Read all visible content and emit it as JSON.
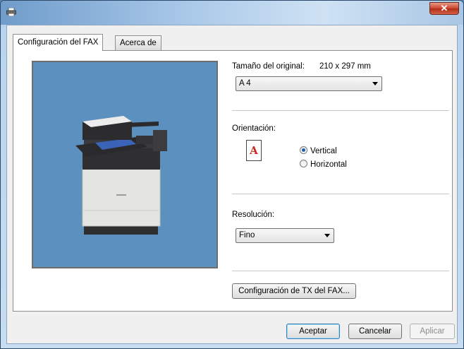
{
  "window": {
    "title": ""
  },
  "tabs": [
    {
      "label": "Configuración del FAX",
      "active": true
    },
    {
      "label": "Acerca de",
      "active": false
    }
  ],
  "original_size": {
    "label": "Tamaño del original:",
    "dimensions": "210 x 297 mm",
    "selected": "A 4"
  },
  "orientation": {
    "label": "Orientación:",
    "icon_letter": "A",
    "options": [
      {
        "label": "Vertical",
        "checked": true
      },
      {
        "label": "Horizontal",
        "checked": false
      }
    ]
  },
  "resolution": {
    "label": "Resolución:",
    "selected": "Fino"
  },
  "tx_settings_button": "Configuración de TX del FAX...",
  "footer": {
    "ok": "Aceptar",
    "cancel": "Cancelar",
    "apply": "Aplicar"
  },
  "colors": {
    "preview_bg": "#5b90bf",
    "orientation_letter": "#c22a1e"
  }
}
